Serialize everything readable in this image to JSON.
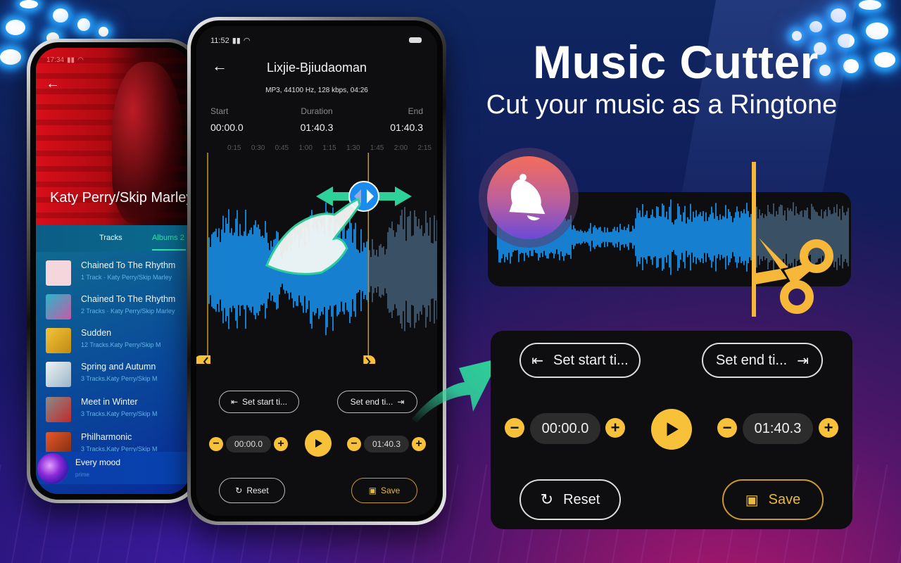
{
  "headline": {
    "title": "Music Cutter",
    "subtitle": "Cut your music as a Ringtone"
  },
  "phone_library": {
    "status_time": "17:34",
    "back_icon": "arrow-left-icon",
    "artist": "Katy Perry/Skip Marley",
    "tabs": [
      {
        "label": "Tracks",
        "active": false
      },
      {
        "label": "Albums 2",
        "active": true
      }
    ],
    "albums": [
      {
        "title": "Chained To The Rhythm",
        "subtitle": "1 Track · Katy Perry/Skip Marley",
        "thumb_color": "#f4d6dc"
      },
      {
        "title": "Chained To The Rhythm",
        "subtitle": "2 Tracks · Katy Perry/Skip Marley",
        "thumb_color": "#c65aa8"
      },
      {
        "title": "Sudden",
        "subtitle": "12 Tracks.Katy Perry/Skip M",
        "thumb_color": "#e8b92a"
      },
      {
        "title": "Spring and Autumn",
        "subtitle": "3 Tracks.Katy Perry/Skip M",
        "thumb_color": "#d8e4ee"
      },
      {
        "title": "Meet in Winter",
        "subtitle": "3 Tracks.Katy Perry/Skip M",
        "thumb_color": "#b84848"
      },
      {
        "title": "Philharmonic",
        "subtitle": "3 Tracks.Katy Perry/Skip M",
        "thumb_color": "#e2622c"
      }
    ],
    "now_playing": {
      "title": "Every mood",
      "subtitle": "prime"
    }
  },
  "phone_cutter": {
    "status_time": "11:52",
    "title": "Lixjie-Bjiudaoman",
    "meta": "MP3, 44100 Hz, 128 kbps, 04:26",
    "labels": {
      "start": "Start",
      "duration": "Duration",
      "end": "End"
    },
    "values": {
      "start": "00:00.0",
      "duration": "01:40.3",
      "end": "01:40.3"
    },
    "timeline_ticks": [
      "0:15",
      "0:30",
      "0:45",
      "1:00",
      "1:15",
      "1:30",
      "1:45",
      "2:00",
      "2:15"
    ],
    "selection_end_fraction": 0.69,
    "set_start_label": "Set start ti...",
    "set_end_label": "Set end ti...",
    "start_time": "00:00.0",
    "end_time": "01:40.3",
    "reset_label": "Reset",
    "save_label": "Save"
  },
  "controls_panel": {
    "set_start_label": "Set start ti...",
    "set_end_label": "Set end ti...",
    "start_time": "00:00.0",
    "end_time": "01:40.3",
    "reset_label": "Reset",
    "save_label": "Save"
  },
  "colors": {
    "accent_yellow": "#f7c13a",
    "wave_blue": "#1a9cff",
    "wave_muted": "#46617a",
    "arrow_green": "#2fd19a"
  }
}
